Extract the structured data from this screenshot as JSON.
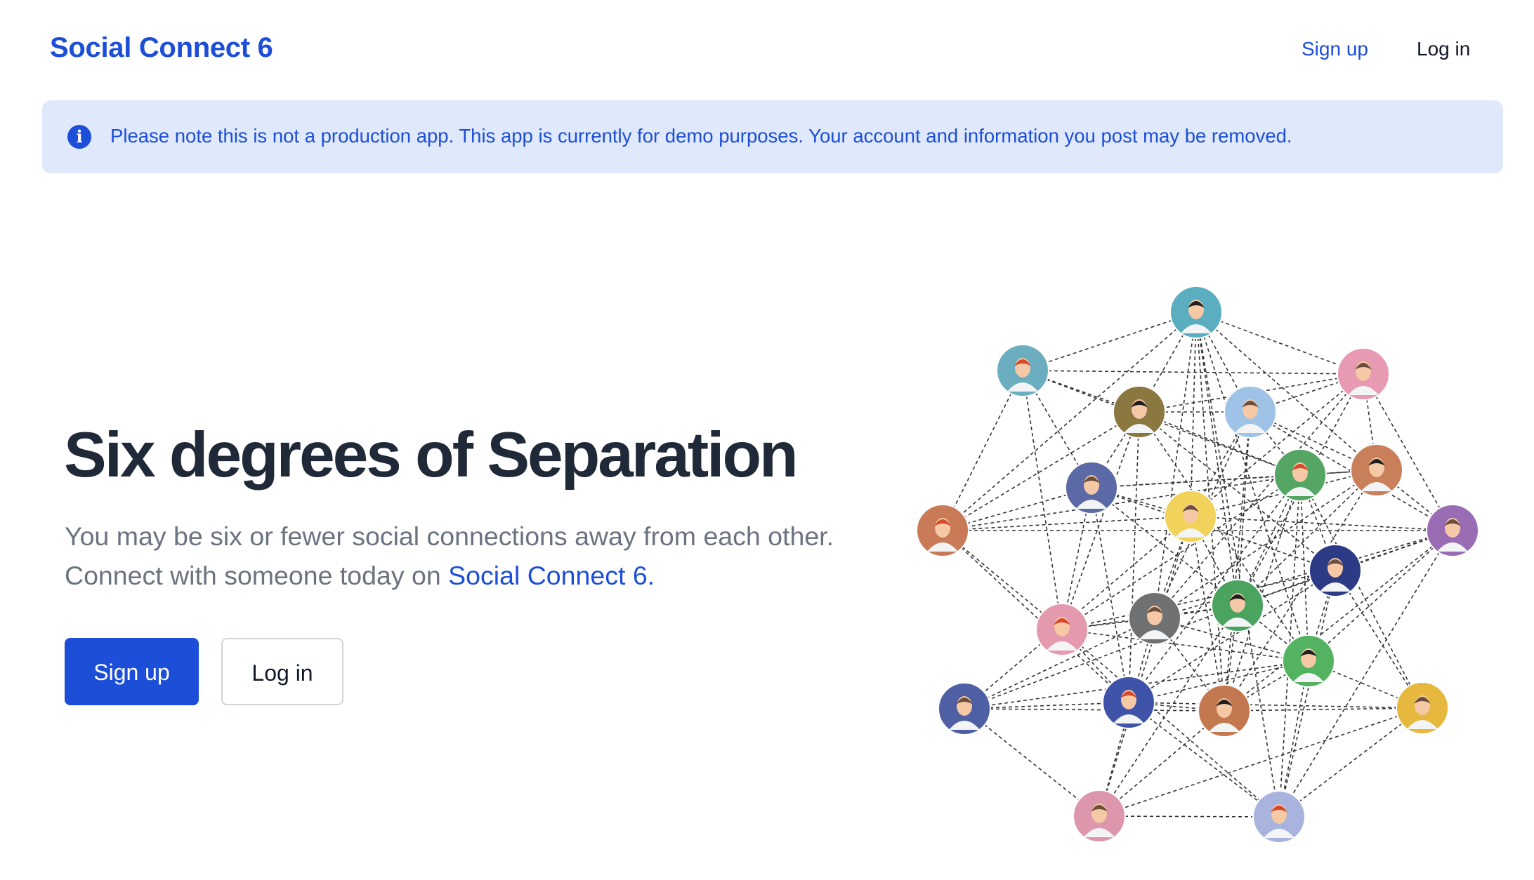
{
  "nav": {
    "brand": "Social Connect 6",
    "signup_label": "Sign up",
    "login_label": "Log in"
  },
  "alert": {
    "icon": "info-circle-icon",
    "message": "Please note this is not a production app. This app is currently for demo purposes. Your account and information you post may be removed."
  },
  "hero": {
    "title": "Six degrees of Separation",
    "line1": "You may be six or fewer social connections away from each other.",
    "line2_prefix": "Connect with someone today on ",
    "line2_link": "Social Connect 6.",
    "signup_button": "Sign up",
    "login_button": "Log in"
  },
  "illustration": {
    "icon": "people-network-illustration",
    "person_colors": [
      "#5aaec0",
      "#6aaebf",
      "#e79ab2",
      "#8b7740",
      "#9ec3e6",
      "#55a564",
      "#c9805a",
      "#5b6aa6",
      "#f1d35c",
      "#c97b58",
      "#9a6cb3",
      "#2d3a86",
      "#4aa35e",
      "#e599ae",
      "#6f7173",
      "#54b361",
      "#4f5fa4",
      "#3f53a8",
      "#c4784f",
      "#e6b83e",
      "#dd97ad",
      "#a9b4de"
    ],
    "colors": {
      "accent": "#1d4ed8",
      "alert_bg": "#dfe9fb",
      "title": "#1f2937",
      "muted": "#6b7280"
    }
  }
}
